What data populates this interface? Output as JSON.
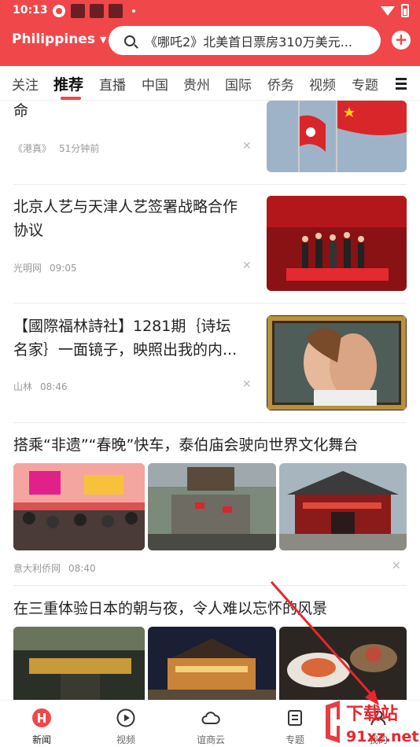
{
  "status_bar": {
    "time": "10:13"
  },
  "header": {
    "region": "Philippines",
    "search_text": "《哪吒2》北美首日票房310万美元..."
  },
  "tabs": [
    "关注",
    "推荐",
    "直播",
    "中国",
    "贵州",
    "国际",
    "侨务",
    "视频",
    "专题"
  ],
  "articles": [
    {
      "title": "命",
      "source": "《港真》",
      "time": "51分钟前"
    },
    {
      "title_line1": "北京人艺与天津人艺签署战略合作",
      "title_line2": "协议",
      "source": "光明网",
      "time": "09:05"
    },
    {
      "title_line1": "【國際福林詩社】1281期｛诗坛",
      "title_line2": "名家｝一面镜子，映照出我的内...",
      "source": "山林",
      "time": "08:46"
    },
    {
      "title": "搭乘“非遗”“春晚”快车，泰伯庙会驶向世界文化舞台",
      "source": "意大利侨网",
      "time": "08:40"
    },
    {
      "title": "在三重体验日本的朝与夜，令人难以忘怀的风景"
    }
  ],
  "bottom_nav": [
    "新闻",
    "视频",
    "谊商云",
    "专题",
    "我的"
  ],
  "watermark": {
    "line1": "下载站",
    "line2": "91xz.net"
  },
  "colors": {
    "accent": "#f0474a"
  }
}
